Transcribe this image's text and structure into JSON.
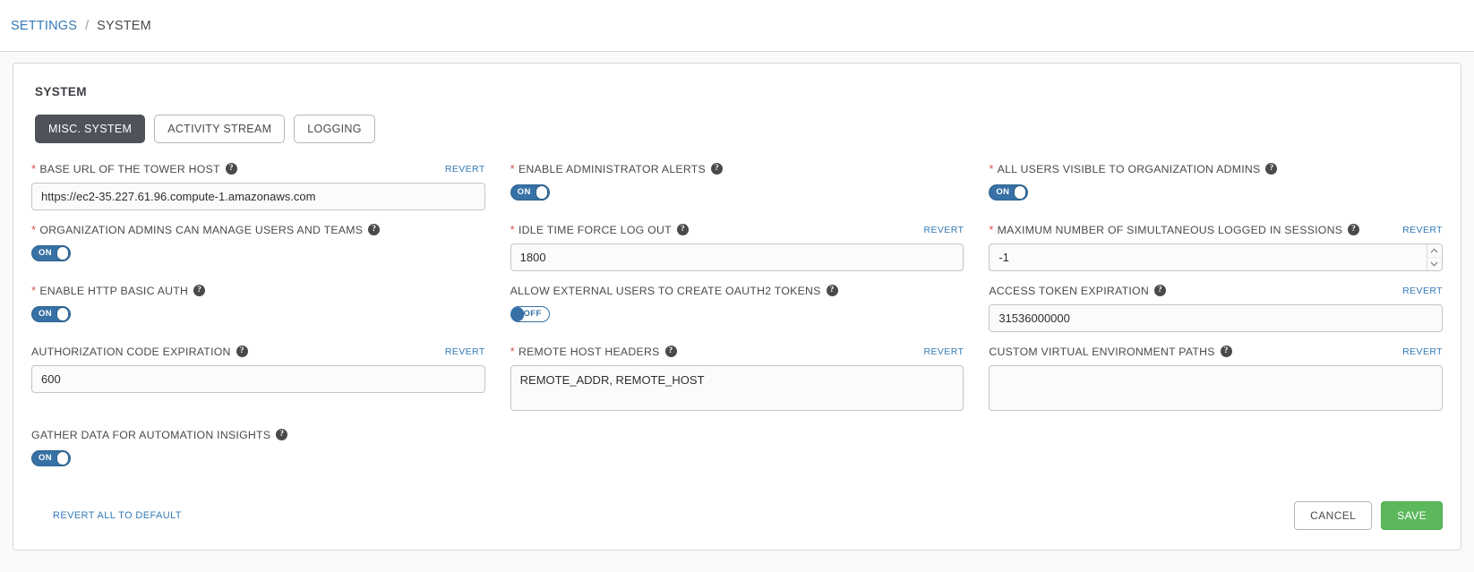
{
  "breadcrumb": {
    "parent": "SETTINGS",
    "separator": "/",
    "current": "SYSTEM"
  },
  "card": {
    "title": "SYSTEM"
  },
  "tabs": [
    {
      "label": "MISC. SYSTEM",
      "active": true
    },
    {
      "label": "ACTIVITY STREAM",
      "active": false
    },
    {
      "label": "LOGGING",
      "active": false
    }
  ],
  "common": {
    "revert_label": "REVERT",
    "help_glyph": "?",
    "required_glyph": "*",
    "toggle_on": "ON",
    "toggle_off": "OFF",
    "spinner_up": "▲",
    "spinner_down": "▼"
  },
  "fields": {
    "base_url": {
      "label": "BASE URL OF THE TOWER HOST",
      "required": true,
      "revert": "REVERT",
      "value": "https://ec2-35.227.61.96.compute-1.amazonaws.com"
    },
    "admin_alerts": {
      "label": "ENABLE ADMINISTRATOR ALERTS",
      "required": true,
      "state": "ON"
    },
    "all_users_visible": {
      "label": "ALL USERS VISIBLE TO ORGANIZATION ADMINS",
      "required": true,
      "state": "ON"
    },
    "org_admins_manage": {
      "label": "ORGANIZATION ADMINS CAN MANAGE USERS AND TEAMS",
      "required": true,
      "state": "ON"
    },
    "idle_time": {
      "label": "IDLE TIME FORCE LOG OUT",
      "required": true,
      "revert": "REVERT",
      "value": "1800"
    },
    "max_sessions": {
      "label": "MAXIMUM NUMBER OF SIMULTANEOUS LOGGED IN SESSIONS",
      "required": true,
      "revert": "REVERT",
      "value": "-1"
    },
    "http_basic_auth": {
      "label": "ENABLE HTTP BASIC AUTH",
      "required": true,
      "state": "ON"
    },
    "external_oauth2": {
      "label": "ALLOW EXTERNAL USERS TO CREATE OAUTH2 TOKENS",
      "required": false,
      "state": "OFF"
    },
    "access_token_expiration": {
      "label": "ACCESS TOKEN EXPIRATION",
      "required": false,
      "revert": "REVERT",
      "value": "31536000000"
    },
    "auth_code_expiration": {
      "label": "AUTHORIZATION CODE EXPIRATION",
      "required": false,
      "revert": "REVERT",
      "value": "600"
    },
    "remote_host_headers": {
      "label": "REMOTE HOST HEADERS",
      "required": true,
      "revert": "REVERT",
      "value": "REMOTE_ADDR, REMOTE_HOST"
    },
    "custom_venv_paths": {
      "label": "CUSTOM VIRTUAL ENVIRONMENT PATHS",
      "required": false,
      "revert": "REVERT",
      "value": ""
    },
    "automation_insights": {
      "label": "GATHER DATA FOR AUTOMATION INSIGHTS",
      "required": false,
      "state": "ON"
    }
  },
  "footer": {
    "revert_all": "REVERT ALL TO DEFAULT",
    "cancel": "CANCEL",
    "save": "SAVE"
  },
  "colors": {
    "link": "#337ab7",
    "required": "#d9534f",
    "toggle_blue": "#3771a6",
    "save_green": "#5cb85c",
    "tab_active": "#4f5259"
  }
}
